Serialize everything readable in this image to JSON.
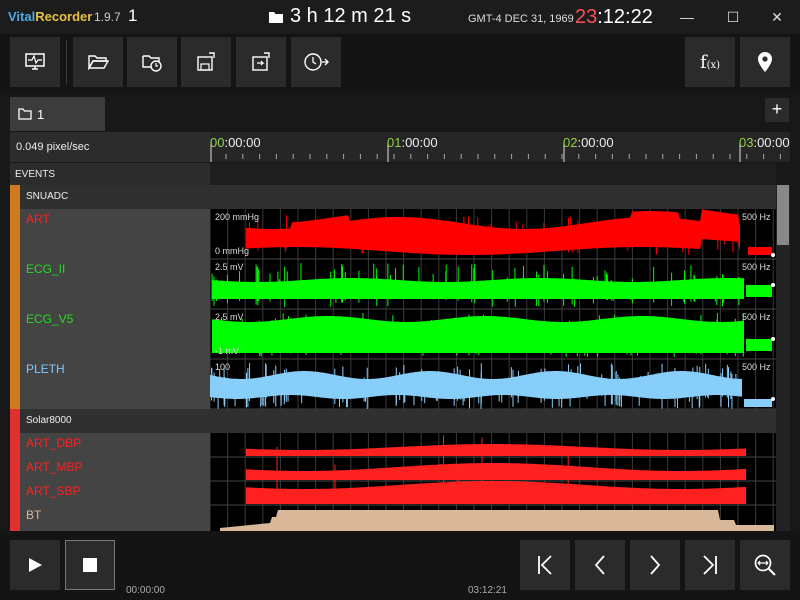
{
  "title_bar": {
    "app_name_vital": "Vital",
    "app_name_recorder": "Recorder",
    "version": "1.9.7",
    "window_number": "1",
    "duration": "3 h 12 m 21 s",
    "timezone_date": "GMT-4  DEC 31, 1969",
    "clock_hour": "23",
    "clock_rest": ":12:22",
    "minimize": "—",
    "maximize": "☐",
    "close": "✕"
  },
  "toolbar": {
    "fx_label": "f",
    "fx_sub": "(x)",
    "buttons": [
      "monitor-icon",
      "open-folder-icon",
      "recent-folder-icon",
      "save-icon",
      "save-as-icon",
      "timer-export-icon",
      "function-icon",
      "location-pin-icon"
    ]
  },
  "tabs": [
    {
      "label": "1"
    }
  ],
  "tab_add": "+",
  "timeline": {
    "scale": "0.049 pixel/sec",
    "ticks": [
      {
        "prefix": "00",
        "rest": ":00:00"
      },
      {
        "prefix": "01",
        "rest": ":00:00"
      },
      {
        "prefix": "02",
        "rest": ":00:00"
      },
      {
        "prefix": "03",
        "rest": ":00:00"
      }
    ]
  },
  "events_label": "EVENTS",
  "groups": [
    {
      "name": "SNUADC",
      "color": "#d07a20",
      "tracks": [
        {
          "name": "ART",
          "color": "#ff2020",
          "wave_color": "#ff0000",
          "min_label": "0 mmHg",
          "max_label": "200 mmHg",
          "rate": "500 Hz"
        },
        {
          "name": "ECG_II",
          "color": "#22dd22",
          "wave_color": "#00ff00",
          "min_label": "",
          "max_label": "2.5 mV",
          "rate": "500 Hz"
        },
        {
          "name": "ECG_V5",
          "color": "#22dd22",
          "wave_color": "#00ff00",
          "min_label": "-1 mV",
          "max_label": "2.5 mV",
          "rate": "500 Hz"
        },
        {
          "name": "PLETH",
          "color": "#7ec8ff",
          "wave_color": "#87cefa",
          "min_label": "",
          "max_label": "100",
          "rate": "500 Hz"
        }
      ]
    },
    {
      "name": "Solar8000",
      "color": "#e03030",
      "tracks": [
        {
          "name": "ART_DBP",
          "color": "#ff2020"
        },
        {
          "name": "ART_MBP",
          "color": "#ff2020"
        },
        {
          "name": "ART_SBP",
          "color": "#ff2020"
        },
        {
          "name": "BT",
          "color": "#d8b898"
        }
      ]
    }
  ],
  "playback": {
    "start_time": "00:00:00",
    "end_time": "03:12:21",
    "buttons": [
      "play-icon",
      "stop-icon",
      "skip-start-icon",
      "prev-icon",
      "next-icon",
      "skip-end-icon",
      "zoom-fit-icon"
    ]
  }
}
